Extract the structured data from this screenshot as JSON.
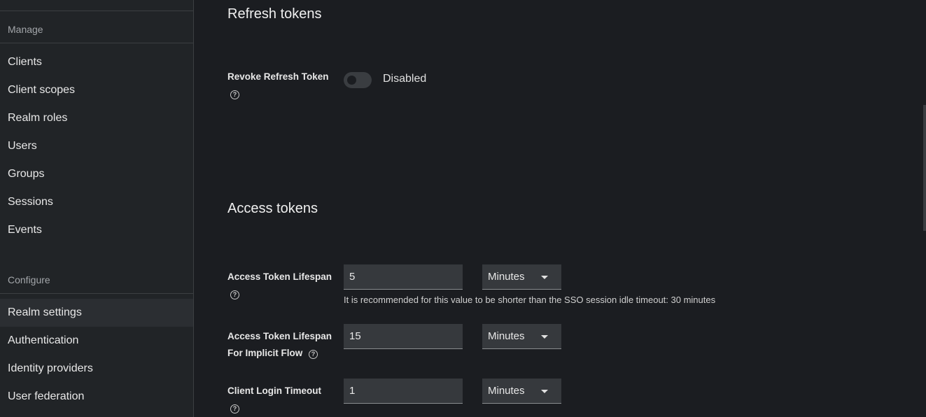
{
  "sidebar": {
    "manage_label": "Manage",
    "configure_label": "Configure",
    "manage_items": [
      "Clients",
      "Client scopes",
      "Realm roles",
      "Users",
      "Groups",
      "Sessions",
      "Events"
    ],
    "configure_items": [
      "Realm settings",
      "Authentication",
      "Identity providers",
      "User federation"
    ],
    "active_item": "Realm settings"
  },
  "refresh_tokens": {
    "heading": "Refresh tokens",
    "revoke_label": "Revoke Refresh Token",
    "revoke_state": "Disabled",
    "revoke_enabled": false
  },
  "access_tokens": {
    "heading": "Access tokens",
    "lifespan": {
      "label": "Access Token Lifespan",
      "value": "5",
      "unit": "Minutes",
      "helper": "It is recommended for this value to be shorter than the SSO session idle timeout: 30 minutes"
    },
    "implicit": {
      "label_line1": "Access Token Lifespan",
      "label_line2": "For Implicit Flow",
      "value": "15",
      "unit": "Minutes"
    },
    "client_login": {
      "label": "Client Login Timeout",
      "value": "1",
      "unit": "Minutes"
    }
  },
  "icons": {
    "help": "help-circle-icon",
    "dropdown": "caret-down-icon"
  },
  "help_glyph": "?",
  "colors": {
    "background": "#1b1d21",
    "sidebar": "#212427",
    "active": "#2b2e32",
    "input": "#36393d"
  }
}
